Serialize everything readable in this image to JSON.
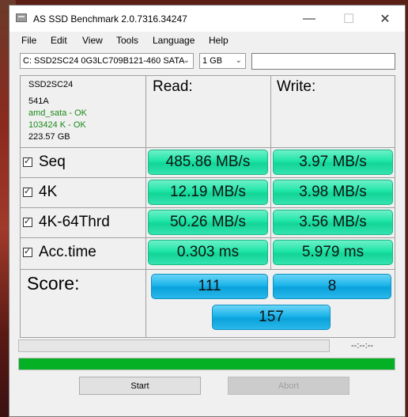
{
  "window": {
    "title": "AS SSD Benchmark 2.0.7316.34247"
  },
  "menu": [
    "File",
    "Edit",
    "View",
    "Tools",
    "Language",
    "Help"
  ],
  "toolbar": {
    "drive_select": "C: SSD2SC24 0G3LC709B121-460 SATA",
    "size_select": "1 GB",
    "text_value": ""
  },
  "drive_info": {
    "model": "SSD2SC24",
    "firmware": "541A",
    "driver": "amd_sata - OK",
    "alignment": "103424 K - OK",
    "capacity": "223.57 GB"
  },
  "columns": {
    "read": "Read:",
    "write": "Write:"
  },
  "rows": [
    {
      "label": "Seq",
      "checked": true,
      "read": "485.86 MB/s",
      "write": "3.97 MB/s"
    },
    {
      "label": "4K",
      "checked": true,
      "read": "12.19 MB/s",
      "write": "3.98 MB/s"
    },
    {
      "label": "4K-64Thrd",
      "checked": true,
      "read": "50.26 MB/s",
      "write": "3.56 MB/s"
    },
    {
      "label": "Acc.time",
      "checked": true,
      "read": "0.303 ms",
      "write": "5.979 ms"
    }
  ],
  "score": {
    "label": "Score:",
    "read": "111",
    "write": "8",
    "total": "157"
  },
  "status": {
    "time": "--:--:--",
    "progress1": 0,
    "progress2": 1.0
  },
  "buttons": {
    "start": "Start",
    "abort": "Abort"
  },
  "colors": {
    "result_green": "#1ee6a6",
    "score_blue": "#1cb4ea",
    "progress_green": "#06b025"
  }
}
